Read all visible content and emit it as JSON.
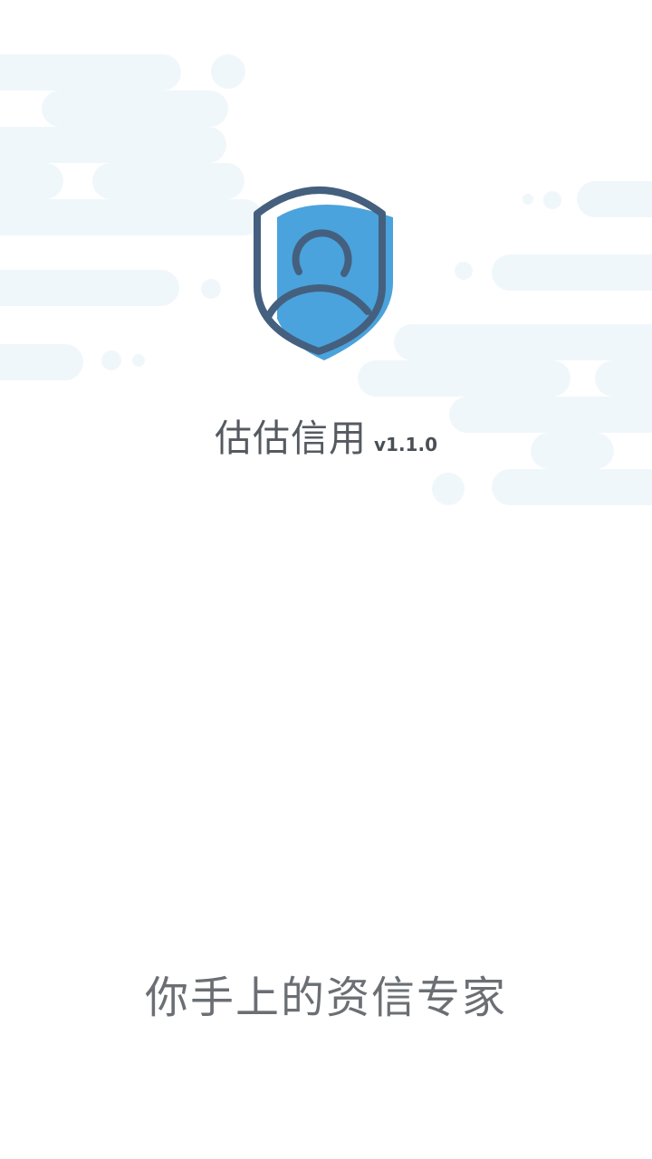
{
  "app": {
    "name": "估估信用",
    "version": "v1.1.0"
  },
  "slogan": "你手上的资信专家",
  "colors": {
    "background": "#ffffff",
    "cloud": "#f0f7fb",
    "shield_fill": "#4aa3dc",
    "shield_outline": "#44607e",
    "text": "#555a60"
  },
  "icons": {
    "logo": "shield-user-icon"
  }
}
